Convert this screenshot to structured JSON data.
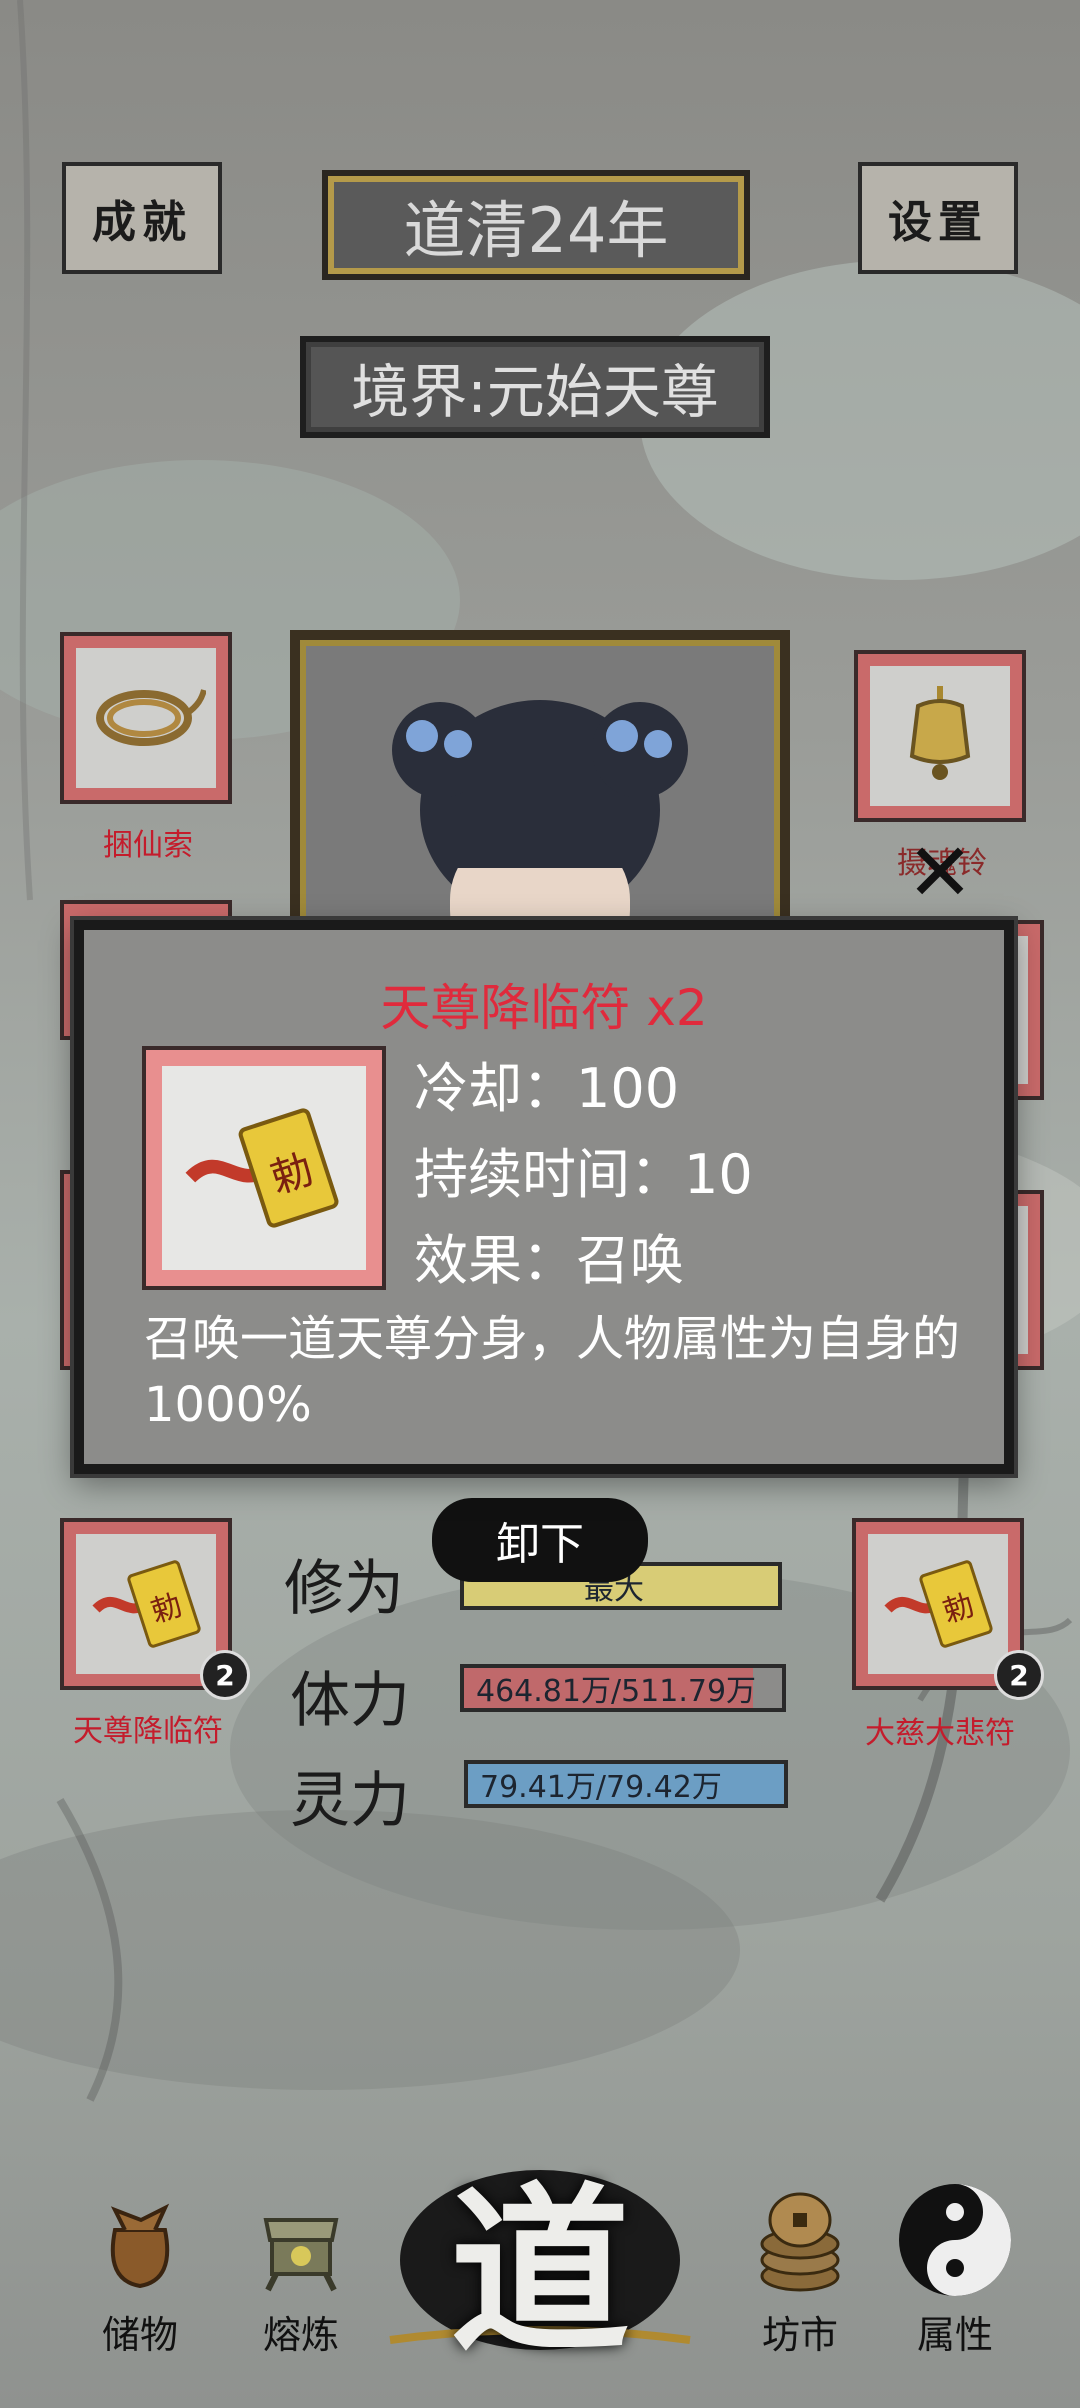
{
  "header": {
    "achievements_label": "成就",
    "settings_label": "设置",
    "year": "道清24年",
    "realm": "境界:元始天尊"
  },
  "slots": {
    "top_left_label": "捆仙索",
    "top_right_label": "摄魂铃",
    "bottom_left_label": "天尊降临符",
    "bottom_left_count": "2",
    "bottom_right_label": "大慈大悲符",
    "bottom_right_count": "2"
  },
  "stats": {
    "cultivation_label": "修为",
    "cultivation_value": "最大",
    "stamina_label": "体力",
    "stamina_value": "464.81万/511.79万",
    "stamina_fraction": 0.908,
    "spirit_label": "灵力",
    "spirit_value": "79.41万/79.42万",
    "spirit_fraction": 0.9999
  },
  "actions": {
    "unequip": "卸下"
  },
  "popup": {
    "title": "天尊降临符 x2",
    "cooldown": "冷却：100",
    "duration": "持续时间：10",
    "effect": "效果：召唤",
    "description": "召唤一道天尊分身，人物属性为自身的1000%"
  },
  "nav": {
    "storage": "储物",
    "smelt": "熔炼",
    "center": "道",
    "market": "坊市",
    "attributes": "属性"
  },
  "colors": {
    "slot_border": "#c96a6a",
    "slot_label": "#c41c2c",
    "stamina_bar": "#c0696b",
    "spirit_bar": "#6c9ec4",
    "cultivation_bar": "#d8cc76",
    "popup_title": "#e02a3c"
  }
}
